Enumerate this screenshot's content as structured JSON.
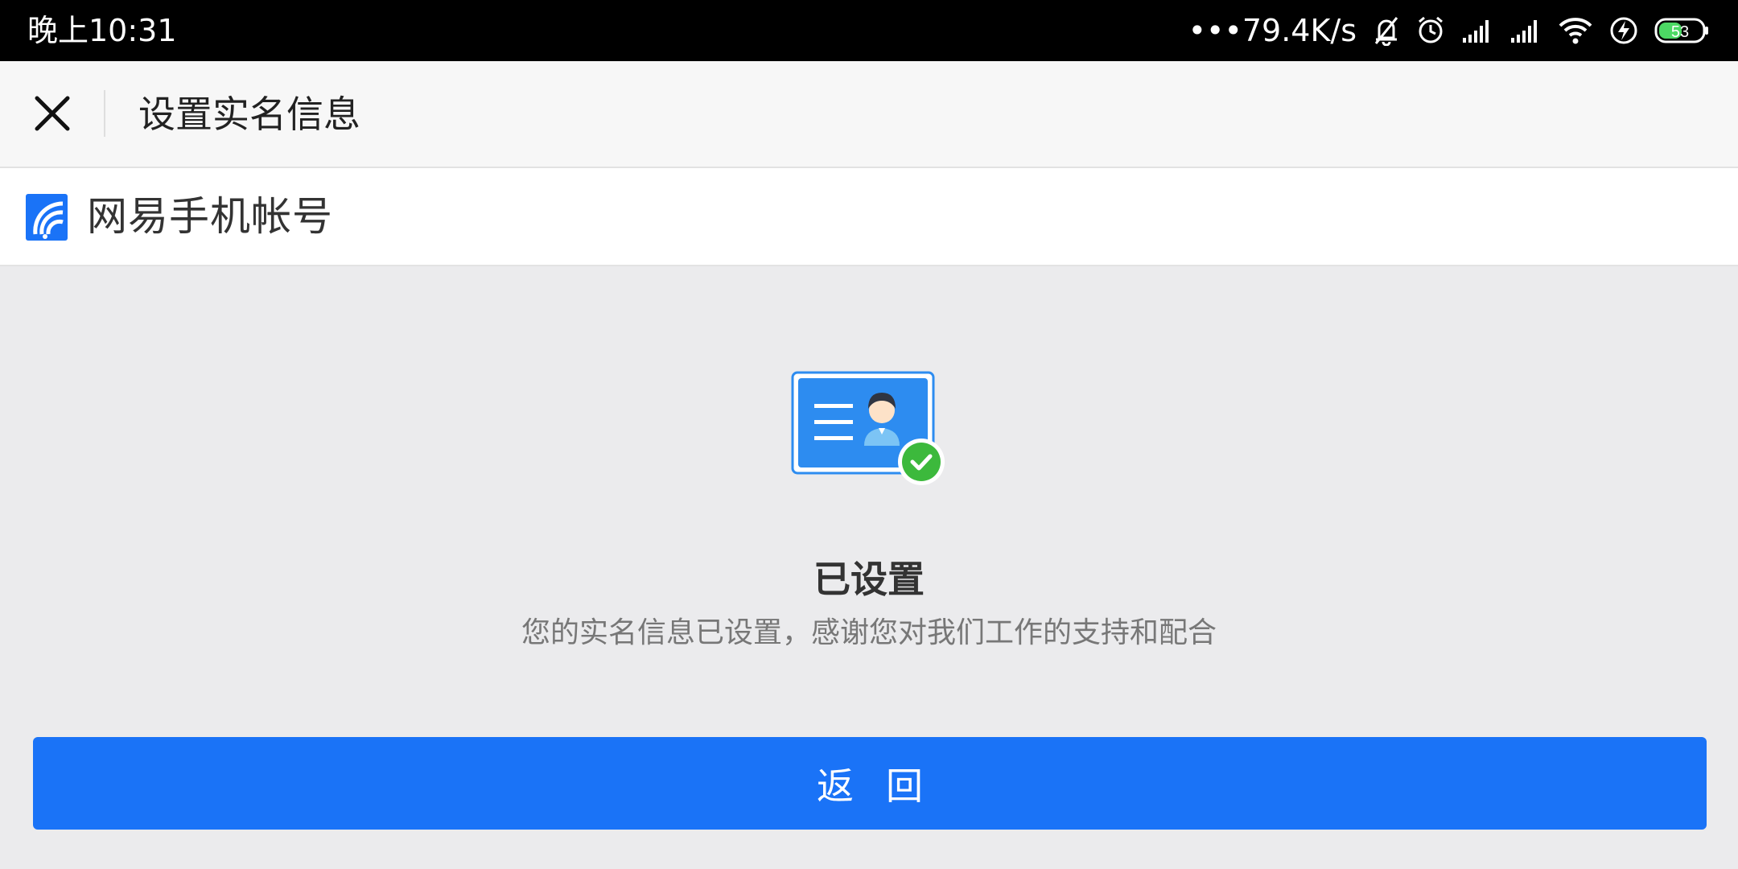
{
  "status_bar": {
    "time": "晚上10:31",
    "network_speed": "•••79.4K/s",
    "battery_level": "53",
    "icons": [
      "mute-bell-icon",
      "alarm-icon",
      "signal-icon",
      "signal-icon",
      "wifi-icon",
      "charging-icon",
      "battery-icon"
    ]
  },
  "header": {
    "close_icon": "close-icon",
    "title": "设置实名信息"
  },
  "brand": {
    "logo_icon": "netease-logo-icon",
    "name": "网易手机帐号"
  },
  "result": {
    "illustration_icon": "id-card-verified-icon",
    "title": "已设置",
    "description": "您的实名信息已设置，感谢您对我们工作的支持和配合"
  },
  "actions": {
    "back_label": "返回"
  },
  "colors": {
    "accent": "#1a73f7",
    "success": "#3cb93c",
    "background": "#ebebed"
  }
}
